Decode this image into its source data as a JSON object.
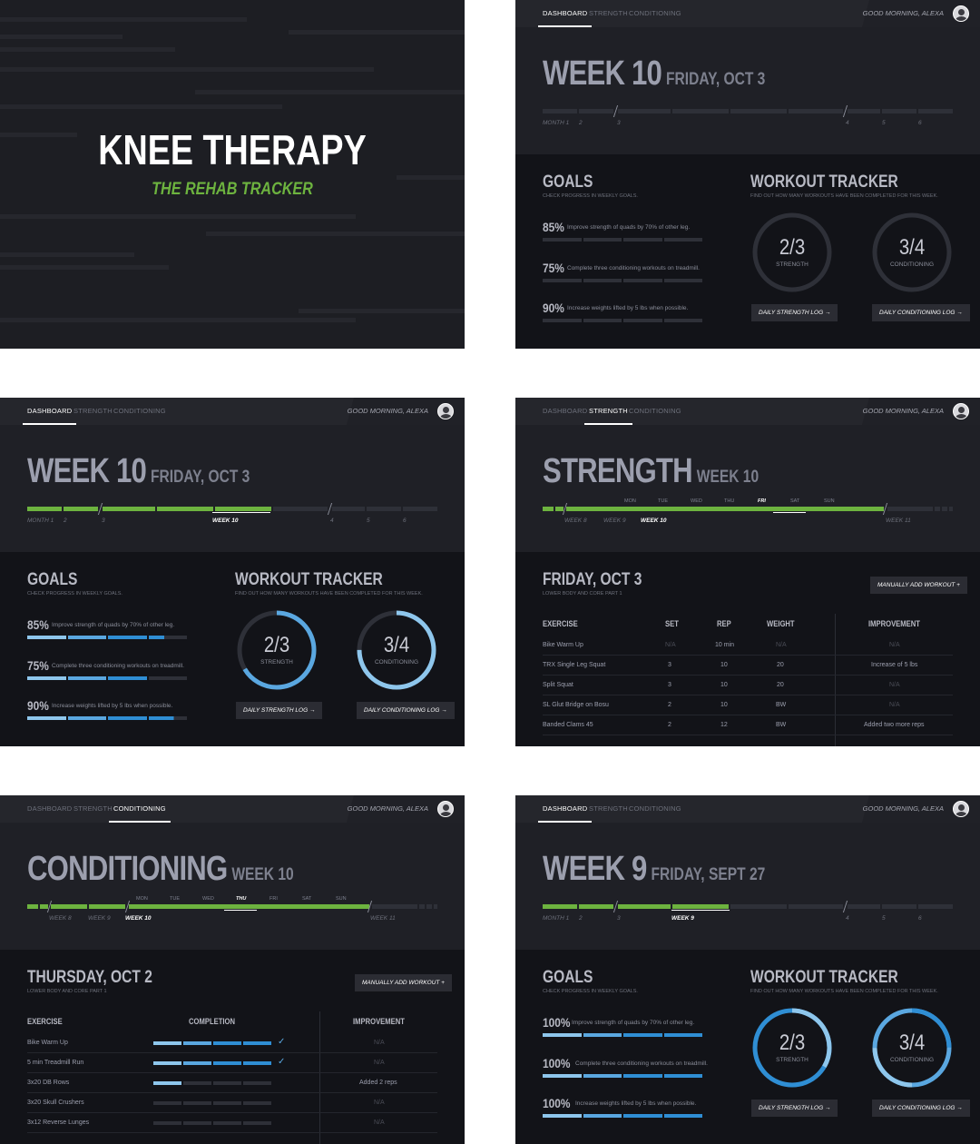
{
  "title_slide": {
    "title": "KNEE THERAPY",
    "subtitle": "THE REHAB TRACKER"
  },
  "nav": {
    "tabs": [
      "DASHBOARD",
      "STRENGTH",
      "CONDITIONING"
    ],
    "greeting": "GOOD MORNING, ALEXA"
  },
  "timeline": {
    "months": [
      "MONTH 1",
      "2",
      "3",
      "4",
      "5",
      "6"
    ],
    "weeks": [
      "WEEK 8",
      "WEEK 9",
      "WEEK 10",
      "WEEK 11"
    ],
    "days": [
      "MON",
      "TUE",
      "WED",
      "THU",
      "FRI",
      "SAT",
      "SUN"
    ]
  },
  "dash_wk10": {
    "week": "WEEK 10",
    "date": "FRIDAY, OCT 3",
    "current_label": "WEEK 10"
  },
  "dash_wk9": {
    "week": "WEEK 9",
    "date": "FRIDAY, SEPT 27",
    "current_label": "WEEK 9"
  },
  "goals": {
    "title": "GOALS",
    "subtitle": "CHECK PROGRESS IN WEEKLY GOALS.",
    "items": [
      "Improve strength of quads by 70% of other leg.",
      "Complete three conditioning workouts on treadmill.",
      "Increase weights lifted by 5 lbs when possible."
    ],
    "pcts_wk10": [
      "85%",
      "75%",
      "90%"
    ],
    "pcts_wk9": [
      "100%",
      "100%",
      "100%"
    ],
    "progress_wk10": [
      0.85,
      0.75,
      0.9
    ],
    "progress_wk9": [
      1,
      1,
      1
    ]
  },
  "tracker": {
    "title": "WORKOUT TRACKER",
    "subtitle": "FIND OUT HOW MANY WORKOUTS HAVE BEEN COMPLETED FOR THIS WEEK.",
    "strength_value": "2/3",
    "strength_label": "STRENGTH",
    "conditioning_value": "3/4",
    "conditioning_label": "CONDITIONING",
    "strength_button": "DAILY STRENGTH LOG →",
    "conditioning_button": "DAILY CONDITIONING LOG →",
    "strength_progress": 0.667,
    "conditioning_progress": 0.75
  },
  "strength": {
    "title": "STRENGTH",
    "week": "WEEK 10",
    "date": "FRIDAY, OCT 3",
    "subtitle": "LOWER BODY AND CORE PART 1",
    "add_button": "MANUALLY ADD WORKOUT  +",
    "headers": [
      "EXERCISE",
      "SET",
      "REP",
      "WEIGHT",
      "IMPROVEMENT"
    ],
    "rows": [
      [
        "Bike Warm Up",
        "N/A",
        "10 min",
        "N/A",
        "N/A"
      ],
      [
        "TRX Single Leg Squat",
        "3",
        "10",
        "20",
        "Increase of 5 lbs"
      ],
      [
        "Split Squat",
        "3",
        "10",
        "20",
        "N/A"
      ],
      [
        "SL Glut Bridge on Bosu",
        "2",
        "10",
        "BW",
        "N/A"
      ],
      [
        "Banded Clams 45",
        "2",
        "12",
        "BW",
        "Added two more reps"
      ]
    ]
  },
  "conditioning": {
    "title": "CONDITIONING",
    "week": "WEEK 10",
    "date": "THURSDAY, OCT 2",
    "subtitle": "LOWER BODY AND CORE PART 1",
    "add_button": "MANUALLY ADD WORKOUT  +",
    "headers": [
      "EXERCISE",
      "COMPLETION",
      "IMPROVEMENT"
    ],
    "rows": [
      {
        "name": "Bike Warm Up",
        "done": 4,
        "check": true,
        "improvement": "N/A"
      },
      {
        "name": "5 min Treadmill Run",
        "done": 4,
        "check": true,
        "improvement": "N/A"
      },
      {
        "name": "3x20 DB Rows",
        "done": 1,
        "check": false,
        "improvement": "Added 2 reps"
      },
      {
        "name": "3x20 Skull Crushers",
        "done": 0,
        "check": false,
        "improvement": "N/A"
      },
      {
        "name": "3x12 Reverse Lunges",
        "done": 0,
        "check": false,
        "improvement": "N/A"
      }
    ]
  },
  "colors": {
    "green": "#6db33f",
    "blue": "#5aa7e0",
    "light_blue": "#8ec6ec",
    "dark_blue": "#2f8ed4"
  }
}
